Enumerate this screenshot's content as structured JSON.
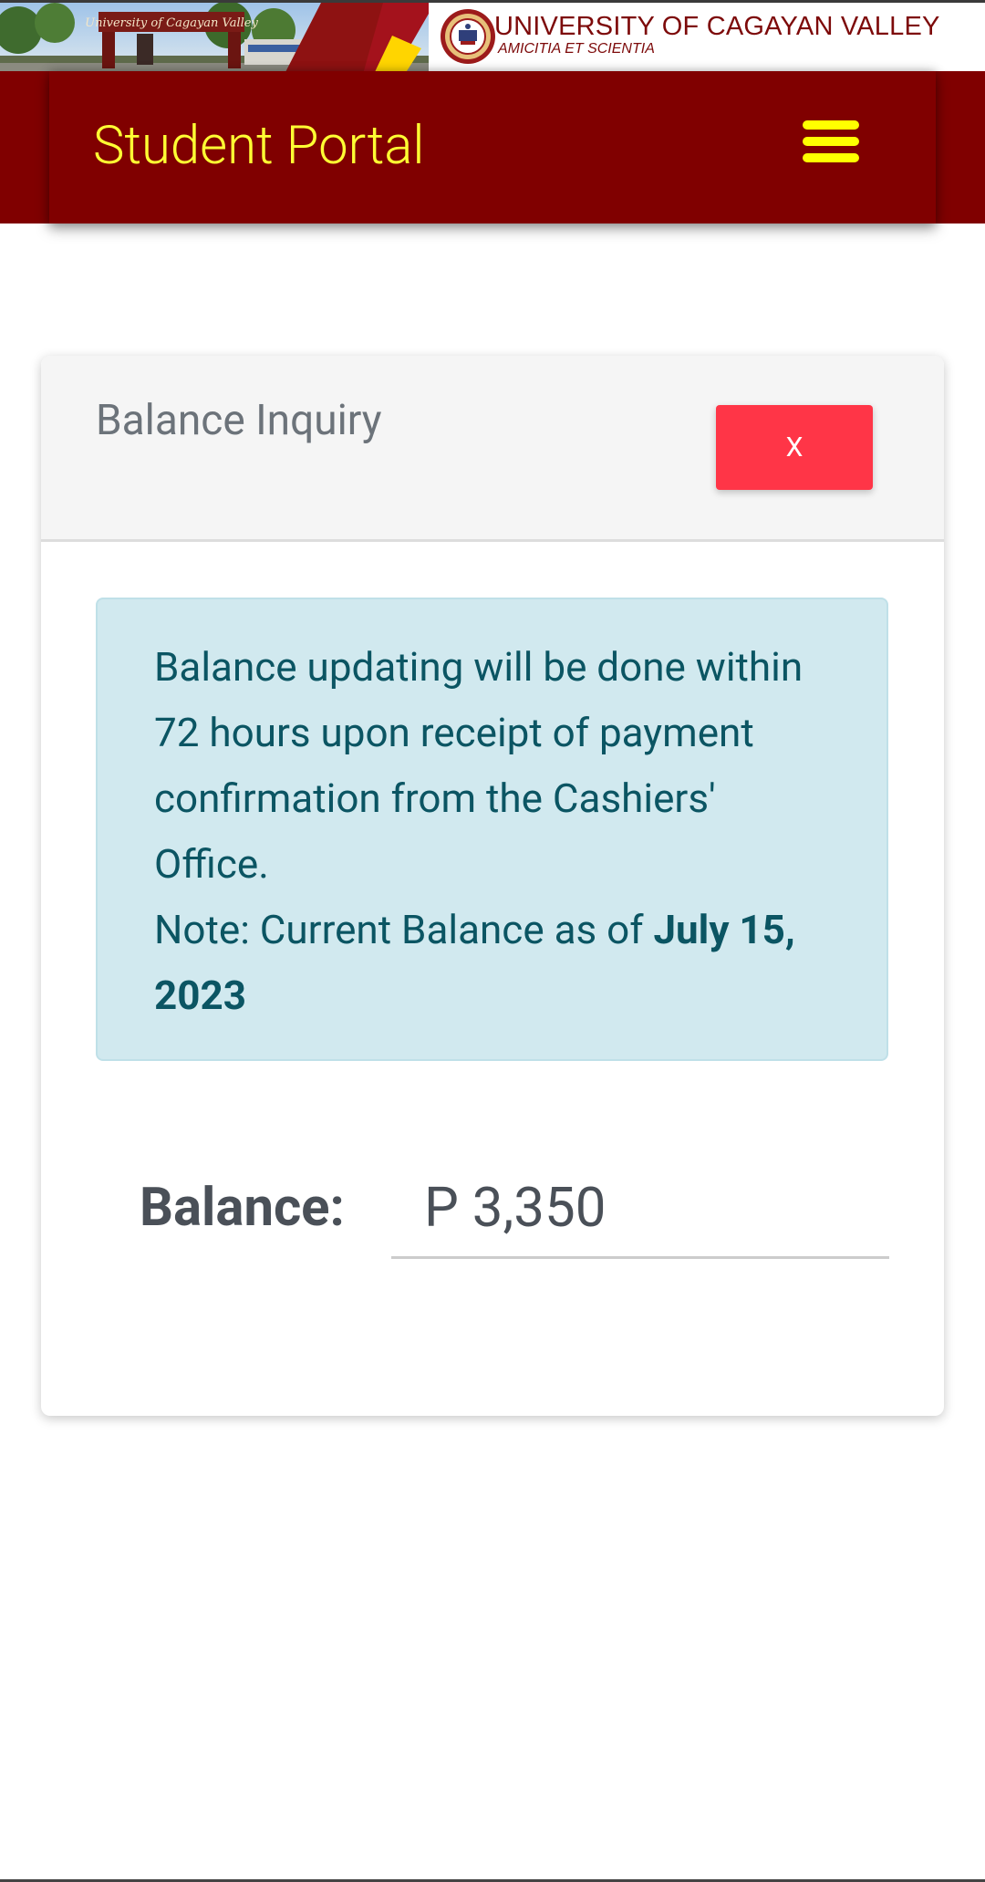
{
  "banner": {
    "university_name": "UNIVERSITY OF CAGAYAN VALLEY",
    "motto": "AMICITIA ET SCIENTIA",
    "photo_icon": "campus-gate-photo",
    "seal_icon": "university-seal-icon"
  },
  "navbar": {
    "brand": "Student Portal",
    "menu_icon": "hamburger-menu-icon"
  },
  "card": {
    "title": "Balance Inquiry",
    "close_label": "X",
    "notice": {
      "text": "Balance updating will be done within 72 hours upon receipt of payment confirmation from the Cashiers' Office.",
      "note_prefix": "Note: Current Balance as of ",
      "note_date": "July 15, 2023"
    },
    "balance": {
      "label": "Balance:",
      "value": "P 3,350"
    }
  },
  "colors": {
    "brand_maroon": "#800000",
    "brand_yellow": "#ffff00",
    "danger": "#ff3547",
    "info_bg": "#d1e9ef",
    "info_text": "#0b5563"
  }
}
